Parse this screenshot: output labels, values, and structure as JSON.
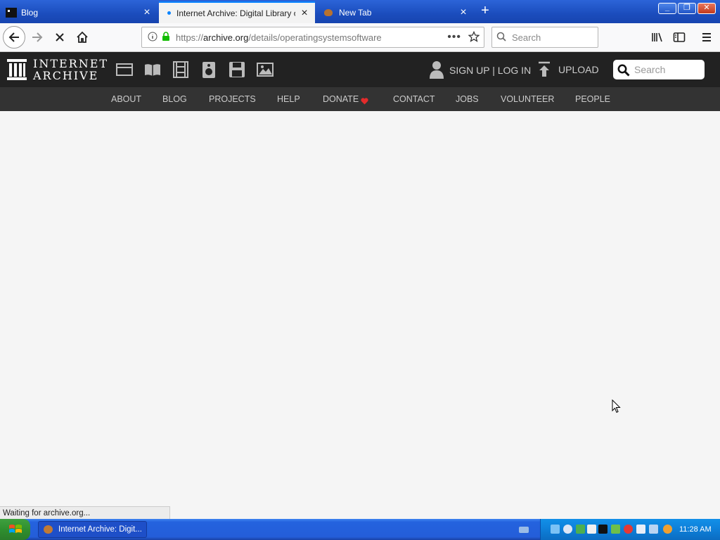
{
  "browser": {
    "tabs": [
      {
        "label": "Blog",
        "active": false
      },
      {
        "label": "Internet Archive: Digital Library of",
        "active": true
      },
      {
        "label": "New Tab",
        "active": false
      }
    ],
    "url": {
      "prefix": "https://",
      "host": "archive.org",
      "path": "/details/operatingsystemsoftware"
    },
    "search_placeholder": "Search",
    "status_text": "Waiting for archive.org..."
  },
  "ia": {
    "logo_line1": "INTERNET",
    "logo_line2": "ARCHIVE",
    "media_icons": [
      "web-icon",
      "texts-icon",
      "video-icon",
      "audio-icon",
      "software-icon",
      "images-icon"
    ],
    "signup_label": "SIGN UP | LOG IN",
    "upload_label": "UPLOAD",
    "search_placeholder": "Search",
    "nav": [
      "ABOUT",
      "BLOG",
      "PROJECTS",
      "HELP",
      "DONATE",
      "CONTACT",
      "JOBS",
      "VOLUNTEER",
      "PEOPLE"
    ],
    "donate_heart_color": "#e42b2b"
  },
  "taskbar": {
    "task_label": "Internet Archive: Digit...",
    "clock": "11:28 AM"
  },
  "colors": {
    "ia_header": "#222222",
    "ia_subnav": "#333333",
    "page_bg": "#f5f5f5",
    "tab_active_accent": "#0a84ff"
  }
}
